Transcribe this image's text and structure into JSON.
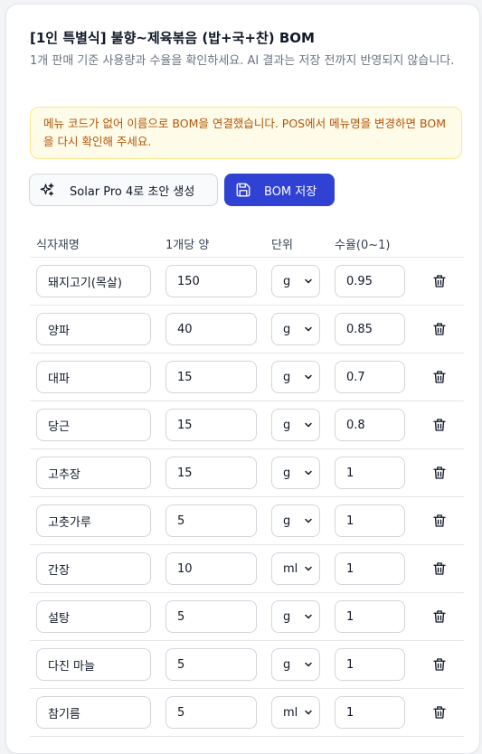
{
  "header": {
    "title": "[1인 특별식] 불향~제육볶음 (밥+국+찬) BOM",
    "subtitle": "1개 판매 기준 사용량과 수율을 확인하세요. AI 결과는 저장 전까지 반영되지 않습니다."
  },
  "notice": {
    "text": "메뉴 코드가 없어 이름으로 BOM을 연결했습니다. POS에서 메뉴명을 변경하면 BOM을 다시 확인해 주세요."
  },
  "toolbar": {
    "solar_label": "Solar Pro 4로 초안 생성",
    "save_label": "BOM 저장"
  },
  "table": {
    "columns": [
      "식자재명",
      "1개당 양",
      "단위",
      "수율(0~1)"
    ],
    "rows": [
      {
        "name": "돼지고기(목살)",
        "qty": "150",
        "unit": "g",
        "yield": "0.95"
      },
      {
        "name": "양파",
        "qty": "40",
        "unit": "g",
        "yield": "0.85"
      },
      {
        "name": "대파",
        "qty": "15",
        "unit": "g",
        "yield": "0.7"
      },
      {
        "name": "당근",
        "qty": "15",
        "unit": "g",
        "yield": "0.8"
      },
      {
        "name": "고추장",
        "qty": "15",
        "unit": "g",
        "yield": "1"
      },
      {
        "name": "고춧가루",
        "qty": "5",
        "unit": "g",
        "yield": "1"
      },
      {
        "name": "간장",
        "qty": "10",
        "unit": "ml",
        "yield": "1"
      },
      {
        "name": "설탕",
        "qty": "5",
        "unit": "g",
        "yield": "1"
      },
      {
        "name": "다진 마늘",
        "qty": "5",
        "unit": "g",
        "yield": "1"
      },
      {
        "name": "참기름",
        "qty": "5",
        "unit": "ml",
        "yield": "1"
      }
    ]
  },
  "icons": {
    "solar": "sparkles-icon",
    "save": "floppy-disk-icon",
    "delete": "trash-icon",
    "select": "chevron-down-icon"
  },
  "colors": {
    "primary": "#2f42d4",
    "notice_bg": "#fefce8",
    "notice_border": "#fde68a",
    "notice_text": "#b45309"
  }
}
